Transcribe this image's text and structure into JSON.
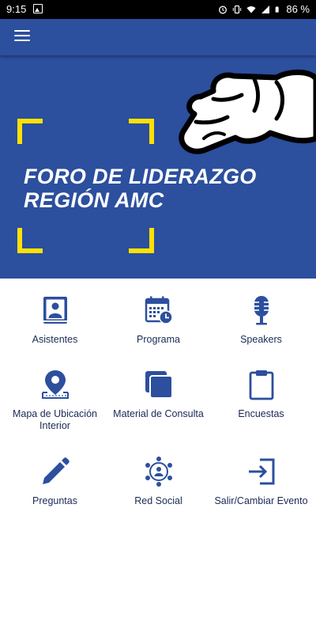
{
  "status_bar": {
    "time": "9:15",
    "battery": "86 %"
  },
  "app_bar": {
    "menu_icon": "hamburger-menu-icon"
  },
  "banner": {
    "title_line1": "FORO DE LIDERAZGO",
    "title_line2": "REGIÓN AMC",
    "accent_color": "#ffe100",
    "background_color": "#2c4f9e"
  },
  "menu": {
    "items": [
      {
        "label": "Asistentes",
        "icon": "attendees-icon"
      },
      {
        "label": "Programa",
        "icon": "calendar-icon"
      },
      {
        "label": "Speakers",
        "icon": "microphone-icon"
      },
      {
        "label": "Mapa de Ubicación Interior",
        "icon": "map-pin-icon"
      },
      {
        "label": "Material de Consulta",
        "icon": "documents-icon"
      },
      {
        "label": "Encuestas",
        "icon": "clipboard-icon"
      },
      {
        "label": "Preguntas",
        "icon": "pencil-icon"
      },
      {
        "label": "Red Social",
        "icon": "social-network-icon"
      },
      {
        "label": "Salir/Cambiar Evento",
        "icon": "exit-icon"
      }
    ]
  }
}
